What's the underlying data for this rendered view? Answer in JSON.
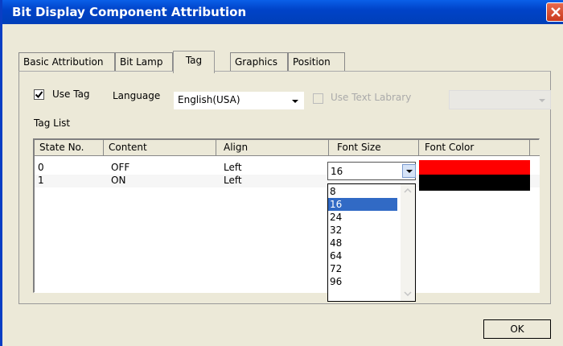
{
  "window": {
    "title": "Bit Display Component Attribution"
  },
  "tabs": [
    "Basic Attribution",
    "Bit Lamp",
    "Tag",
    "Graphics",
    "Position"
  ],
  "active_tab": "Tag",
  "options": {
    "use_tag_label": "Use Tag",
    "use_tag_checked": true,
    "language_label": "Language",
    "language_value": "English(USA)",
    "use_text_library_label": "Use Text Labrary",
    "use_text_library_checked": false
  },
  "tag_list": {
    "label": "Tag List",
    "columns": [
      "State No.",
      "Content",
      "Align",
      "Font Size",
      "Font Color"
    ],
    "rows": [
      {
        "state": "0",
        "content": "OFF",
        "align": "Left",
        "font_size": "16",
        "font_color": "#ff0000"
      },
      {
        "state": "1",
        "content": "ON",
        "align": "Left",
        "font_size": "",
        "font_color": "#000000"
      }
    ]
  },
  "font_size_dropdown": {
    "selected": "16",
    "options": [
      "8",
      "16",
      "24",
      "32",
      "48",
      "64",
      "72",
      "96"
    ]
  },
  "buttons": {
    "ok": "OK"
  }
}
